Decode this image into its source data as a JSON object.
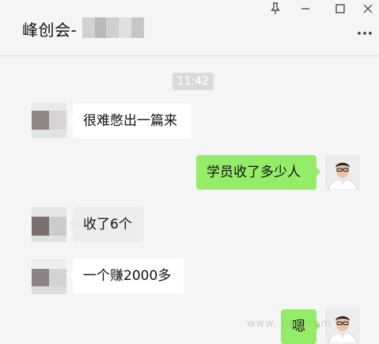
{
  "window": {
    "title": "峰创会-",
    "pin_label": "pin",
    "minimize_label": "minimize",
    "maximize_label": "maximize",
    "close_label": "close"
  },
  "chat": {
    "timestamp": "11:42",
    "messages": [
      {
        "side": "left",
        "text": "很难憋出一篇来"
      },
      {
        "side": "right",
        "text": "学员收了多少人"
      },
      {
        "side": "left",
        "text": "收了6个"
      },
      {
        "side": "left",
        "text": "一个赚2000多"
      },
      {
        "side": "right",
        "text": "嗯"
      }
    ]
  },
  "watermark": "www.        uan.com",
  "colors": {
    "background": "#f5f5f5",
    "incoming_bubble": "#ffffff",
    "outgoing_bubble": "#95ec69",
    "timestamp_bg": "#dadada"
  },
  "icons": {
    "pin": "pin-icon",
    "minimize": "minimize-icon",
    "maximize": "maximize-icon",
    "close": "close-icon",
    "more": "more-icon"
  }
}
